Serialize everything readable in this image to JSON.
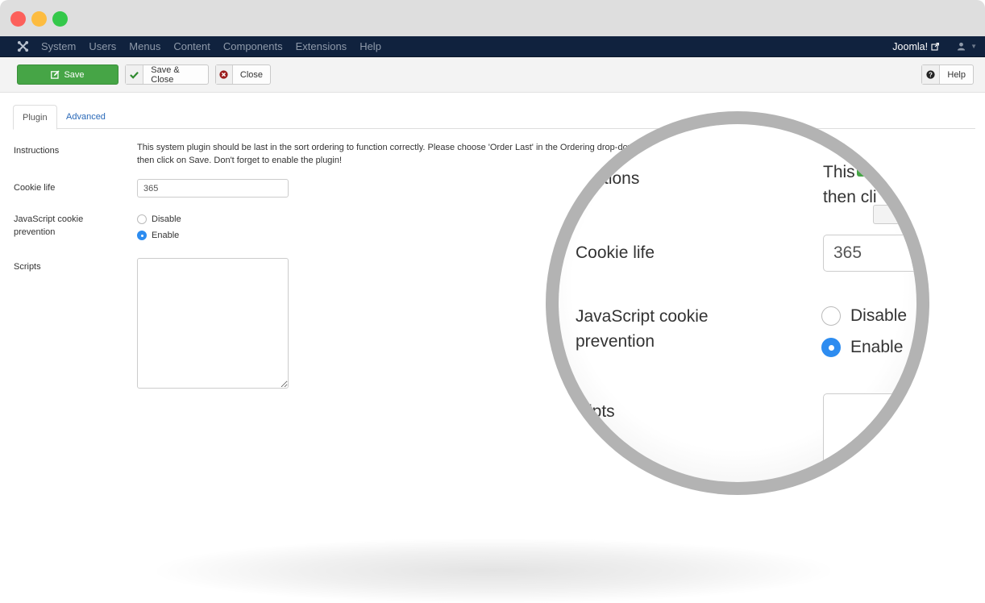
{
  "window": {
    "controls": [
      "close",
      "minimize",
      "maximize"
    ]
  },
  "navbar": {
    "logo_icon": "joomla-logo-icon",
    "menu": [
      "System",
      "Users",
      "Menus",
      "Content",
      "Components",
      "Extensions",
      "Help"
    ],
    "site_link": "Joomla!",
    "site_link_icon": "external-link-icon",
    "user_icon": "user-icon"
  },
  "toolbar": {
    "save_label": "Save",
    "save_close_label": "Save & Close",
    "close_label": "Close",
    "help_label": "Help"
  },
  "tabs": [
    {
      "label": "Plugin",
      "active": true
    },
    {
      "label": "Advanced",
      "active": false
    }
  ],
  "form": {
    "instructions": {
      "label": "Instructions",
      "text_line1": "This system plugin should be last in the sort ordering to function correctly. Please choose 'Order Last' in the Ordering drop-down",
      "text_line2": "then click on Save. Don't forget to enable the plugin!"
    },
    "cookie_life": {
      "label": "Cookie life",
      "value": "365"
    },
    "js_cookie_prevention": {
      "label_line1": "JavaScript cookie",
      "label_line2": "prevention",
      "options": [
        {
          "label": "Disable",
          "checked": false
        },
        {
          "label": "Enable",
          "checked": true
        }
      ]
    },
    "scripts": {
      "label": "Scripts",
      "value": ""
    }
  },
  "magnifier": {
    "instructions_label": "tructions",
    "instructions_text1": "This",
    "instructions_text2": "then cli",
    "cookie_label": "Cookie life",
    "cookie_value": "365",
    "js_label1": "JavaScript cookie",
    "js_label2": "prevention",
    "disable": "Disable",
    "enable": "Enable",
    "scripts_label": "ripts"
  },
  "colors": {
    "navbar": "#10223e",
    "save_green": "#46a546",
    "link_blue": "#2a69b8",
    "radio_blue": "#2d8cf0",
    "close_red": "#9b1c1c"
  }
}
